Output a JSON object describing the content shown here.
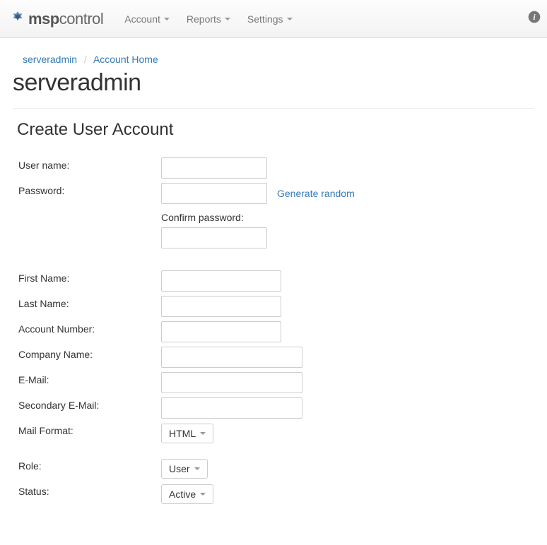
{
  "brand": {
    "bold": "msp",
    "light": "control"
  },
  "nav": {
    "account": "Account",
    "reports": "Reports",
    "settings": "Settings"
  },
  "breadcrumb": {
    "first": "serveradmin",
    "second": "Account Home"
  },
  "page_title": "serveradmin",
  "section_title": "Create User Account",
  "labels": {
    "username": "User name:",
    "password": "Password:",
    "confirm_password": "Confirm password:",
    "first_name": "First Name:",
    "last_name": "Last Name:",
    "account_number": "Account Number:",
    "company_name": "Company Name:",
    "email": "E-Mail:",
    "secondary_email": "Secondary E-Mail:",
    "mail_format": "Mail Format:",
    "role": "Role:",
    "status": "Status:"
  },
  "links": {
    "generate_random": "Generate random"
  },
  "values": {
    "username": "",
    "password": "",
    "confirm_password": "",
    "first_name": "",
    "last_name": "",
    "account_number": "",
    "company_name": "",
    "email": "",
    "secondary_email": "",
    "mail_format": "HTML",
    "role": "User",
    "status": "Active"
  }
}
